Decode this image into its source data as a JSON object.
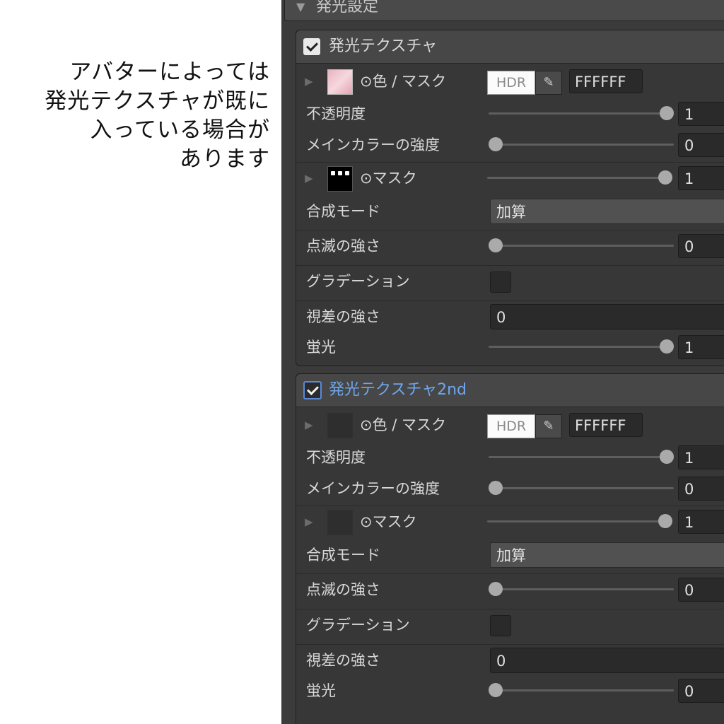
{
  "caption": {
    "lines": [
      "アバターによっては",
      "発光テクスチャが既に",
      "入っている場合が",
      "あります"
    ]
  },
  "panel": {
    "section_title": "発光設定",
    "groups": [
      {
        "title": "発光テクスチャ",
        "enabled": true,
        "title_color": "#d8d8d8",
        "color_label": "⊙色 / マスク",
        "hdr_label": "HDR",
        "color_hex": "FFFFFF",
        "opacity_label": "不透明度",
        "opacity_value": "1",
        "opacity_level": 1,
        "main_color_label": "メインカラーの強度",
        "main_color_value": "0",
        "main_color_level": 0,
        "mask_label": "⊙マスク",
        "mask_value": "1",
        "mask_level": 1,
        "blend_label": "合成モード",
        "blend_value": "加算",
        "blink_label": "点滅の強さ",
        "blink_value": "0",
        "blink_level": 0,
        "gradation_label": "グラデーション",
        "parallax_label": "視差の強さ",
        "parallax_value": "0",
        "fluor_label": "蛍光",
        "fluor_value": "1",
        "fluor_level": 1
      },
      {
        "title": "発光テクスチャ2nd",
        "enabled": true,
        "title_color": "#6ea6ef",
        "color_label": "⊙色 / マスク",
        "hdr_label": "HDR",
        "color_hex": "FFFFFF",
        "opacity_label": "不透明度",
        "opacity_value": "1",
        "opacity_level": 1,
        "main_color_label": "メインカラーの強度",
        "main_color_value": "0",
        "main_color_level": 0,
        "mask_label": "⊙マスク",
        "mask_value": "1",
        "mask_level": 1,
        "blend_label": "合成モード",
        "blend_value": "加算",
        "blink_label": "点滅の強さ",
        "blink_value": "0",
        "blink_level": 0,
        "gradation_label": "グラデーション",
        "parallax_label": "視差の強さ",
        "parallax_value": "0",
        "fluor_label": "蛍光",
        "fluor_value": "0",
        "fluor_level": 0
      }
    ]
  },
  "icons": {
    "foldout": "triangle-right-icon",
    "picker": "eyedropper-icon",
    "section_foldout": "triangle-down-icon"
  },
  "colors": {
    "panel_bg": "#3b3b3b",
    "accent_blue": "#6ea6ef"
  }
}
